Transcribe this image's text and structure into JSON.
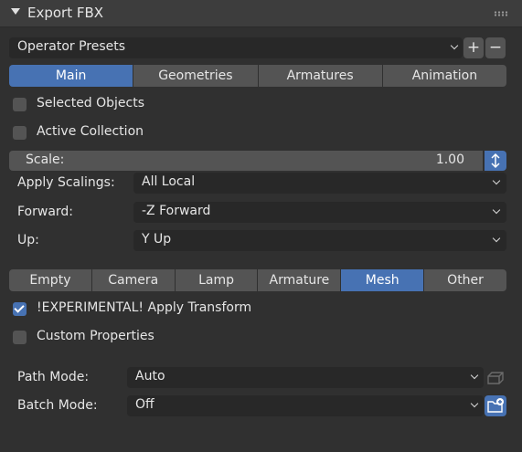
{
  "header": {
    "title": "Export FBX"
  },
  "presets": {
    "label": "Operator Presets",
    "add": "+",
    "remove": "−"
  },
  "main_tabs": [
    "Main",
    "Geometries",
    "Armatures",
    "Animation"
  ],
  "active_main_tab": "Main",
  "checks": {
    "selected_objects": {
      "label": "Selected Objects",
      "checked": false
    },
    "active_collection": {
      "label": "Active Collection",
      "checked": false
    }
  },
  "scale": {
    "label": "Scale:",
    "value": "1.00"
  },
  "apply_scalings": {
    "label": "Apply Scalings:",
    "value": "All Local"
  },
  "forward": {
    "label": "Forward:",
    "value": "-Z Forward"
  },
  "up": {
    "label": "Up:",
    "value": "Y Up"
  },
  "object_types": [
    "Empty",
    "Camera",
    "Lamp",
    "Armature",
    "Mesh",
    "Other"
  ],
  "active_object_type": "Mesh",
  "checks2": {
    "apply_transform": {
      "label": "!EXPERIMENTAL! Apply Transform",
      "checked": true
    },
    "custom_properties": {
      "label": "Custom Properties",
      "checked": false
    }
  },
  "path_mode": {
    "label": "Path Mode:",
    "value": "Auto"
  },
  "batch_mode": {
    "label": "Batch Mode:",
    "value": "Off"
  },
  "colors": {
    "accent": "#4772b3",
    "panel": "#303030",
    "field": "#282828",
    "button": "#545454"
  }
}
